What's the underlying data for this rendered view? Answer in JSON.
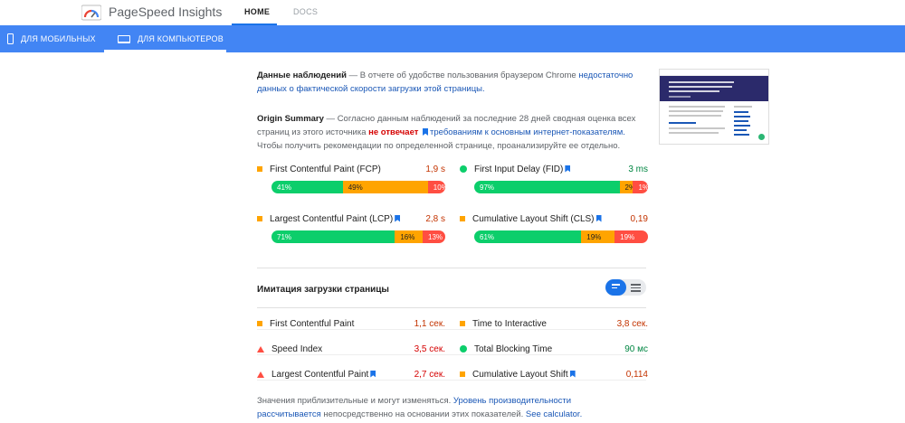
{
  "header": {
    "brand": "PageSpeed Insights",
    "nav": [
      {
        "label": "HOME"
      },
      {
        "label": "DOCS"
      }
    ]
  },
  "devices": [
    {
      "label": "ДЛЯ МОБИЛЬНЫХ",
      "icon": "phone-icon"
    },
    {
      "label": "ДЛЯ КОМПЬЮТЕРОВ",
      "icon": "laptop-icon",
      "selected": true
    }
  ],
  "observations": {
    "title": "Данные наблюдений",
    "text": " — В отчете об удобстве пользования браузером Chrome ",
    "link": "недостаточно данных о фактической скорости загрузки этой страницы."
  },
  "origin": {
    "title": "Origin Summary",
    "text1": " — Согласно данным наблюдений за последние 28 дней сводная оценка всех страниц из этого источника ",
    "status": "не отвечает",
    "link": "требованиям к основным интернет-показателям.",
    "text2": "Чтобы получить рекомендации по определенной странице, проанализируйте ее отдельно."
  },
  "field_metrics": [
    {
      "name": "First Contentful Paint (FCP)",
      "value": "1,9 s",
      "status": "average",
      "flag": false,
      "dist": [
        41,
        49,
        10
      ],
      "labels": [
        "41%",
        "49%",
        "10%"
      ]
    },
    {
      "name": "First Input Delay (FID)",
      "value": "3 ms",
      "status": "pass",
      "flag": true,
      "dist": [
        97,
        2,
        1
      ],
      "labels": [
        "97%",
        "2%",
        "1%"
      ]
    },
    {
      "name": "Largest Contentful Paint (LCP)",
      "value": "2,8 s",
      "status": "average",
      "flag": true,
      "dist": [
        71,
        16,
        13
      ],
      "labels": [
        "71%",
        "16%",
        "13%"
      ]
    },
    {
      "name": "Cumulative Layout Shift (CLS)",
      "value": "0,19",
      "status": "average",
      "flag": true,
      "dist": [
        61,
        19,
        19
      ],
      "labels": [
        "61%",
        "19%",
        "19%"
      ]
    }
  ],
  "lab": {
    "title": "Имитация загрузки страницы",
    "metrics": [
      {
        "name": "First Contentful Paint",
        "value": "1,1 сек.",
        "status": "average",
        "flag": false
      },
      {
        "name": "Time to Interactive",
        "value": "3,8 сек.",
        "status": "average",
        "flag": false
      },
      {
        "name": "Speed Index",
        "value": "3,5 сек.",
        "status": "fail",
        "flag": false
      },
      {
        "name": "Total Blocking Time",
        "value": "90 мс",
        "status": "pass",
        "flag": false
      },
      {
        "name": "Largest Contentful Paint",
        "value": "2,7 сек.",
        "status": "fail",
        "flag": true
      },
      {
        "name": "Cumulative Layout Shift",
        "value": "0,114",
        "status": "average",
        "flag": true
      }
    ]
  },
  "footer": {
    "text1": "Значения приблизительные и могут изменяться. ",
    "link1": "Уровень производительности рассчитывается",
    "text2": " непосредственно на основании этих показателей. ",
    "link2": "See calculator."
  },
  "colors": {
    "accent": "#4285f4",
    "pass": "#0cce6b",
    "average": "#ffa400",
    "fail": "#ff4e42"
  }
}
